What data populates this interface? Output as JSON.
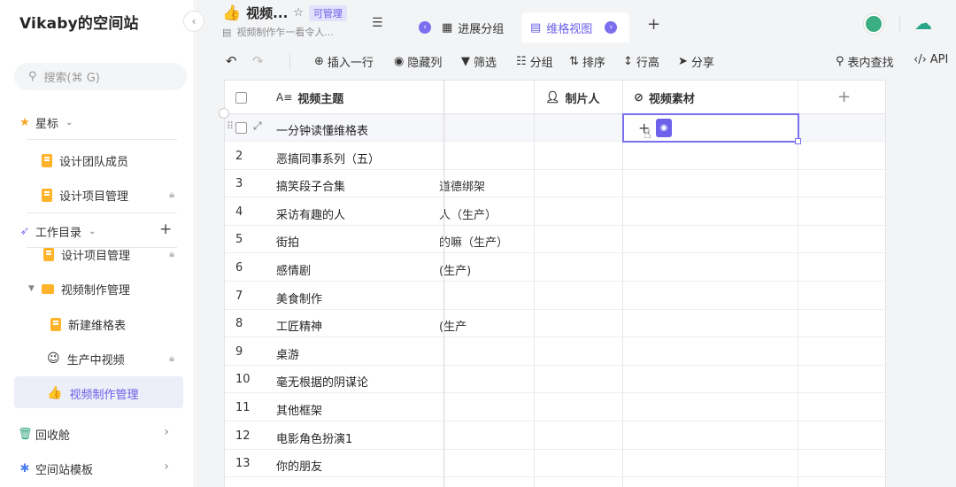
{
  "sidebar": {
    "brand": "Vikaby的空间站",
    "search_placeholder": "搜索(⌘ G)",
    "starred_label": "星标",
    "starred_items": [
      {
        "label": "设计团队成员",
        "locked": false
      },
      {
        "label": "设计项目管理",
        "locked": true
      }
    ],
    "workdir_label": "工作目录",
    "tree": [
      {
        "label": "设计项目管理",
        "locked": true
      },
      {
        "label": "视频制作管理",
        "locked": false
      },
      {
        "label": "新建维格表",
        "locked": false
      },
      {
        "label": "生产中视频",
        "locked": true
      },
      {
        "label": "视频制作管理",
        "locked": false
      }
    ],
    "recycle_label": "回收舱",
    "templates_label": "空间站模板"
  },
  "header": {
    "title": "视频...",
    "badge": "可管理",
    "subtitle": "视频制作乍一看令人...",
    "tabs": [
      {
        "label": "进展分组"
      },
      {
        "label": "维格视图"
      }
    ]
  },
  "toolbar": {
    "insert": "插入一行",
    "hide": "隐藏列",
    "filter": "筛选",
    "group": "分组",
    "sort": "排序",
    "row_height": "行高",
    "share": "分享",
    "find": "表内查找",
    "api": "API"
  },
  "grid": {
    "columns": {
      "title": "视频主题",
      "producer": "制片人",
      "material": "视频素材"
    },
    "rows": [
      {
        "n": "",
        "title": "一分钟读懂维格表",
        "partial": ""
      },
      {
        "n": "2",
        "title": "恶搞同事系列（五）",
        "partial": ""
      },
      {
        "n": "3",
        "title": "搞笑段子合集",
        "partial": "道德绑架"
      },
      {
        "n": "4",
        "title": "采访有趣的人",
        "partial": "人（生产）"
      },
      {
        "n": "5",
        "title": "街拍",
        "partial": "的嘛（生产）"
      },
      {
        "n": "6",
        "title": "感情剧",
        "partial": "(生产)"
      },
      {
        "n": "7",
        "title": "美食制作",
        "partial": ""
      },
      {
        "n": "8",
        "title": "工匠精神",
        "partial": "生产)"
      },
      {
        "n": "9",
        "title": "桌游",
        "partial": ""
      },
      {
        "n": "10",
        "title": "毫无根据的阴谋论",
        "partial": ""
      },
      {
        "n": "11",
        "title": "其他框架",
        "partial": ""
      },
      {
        "n": "12",
        "title": "电影角色扮演1",
        "partial": ""
      },
      {
        "n": "13",
        "title": "你的朋友",
        "partial": ""
      }
    ]
  },
  "colors": {
    "accent": "#6a5ee8",
    "doc": "#ffb32b"
  }
}
